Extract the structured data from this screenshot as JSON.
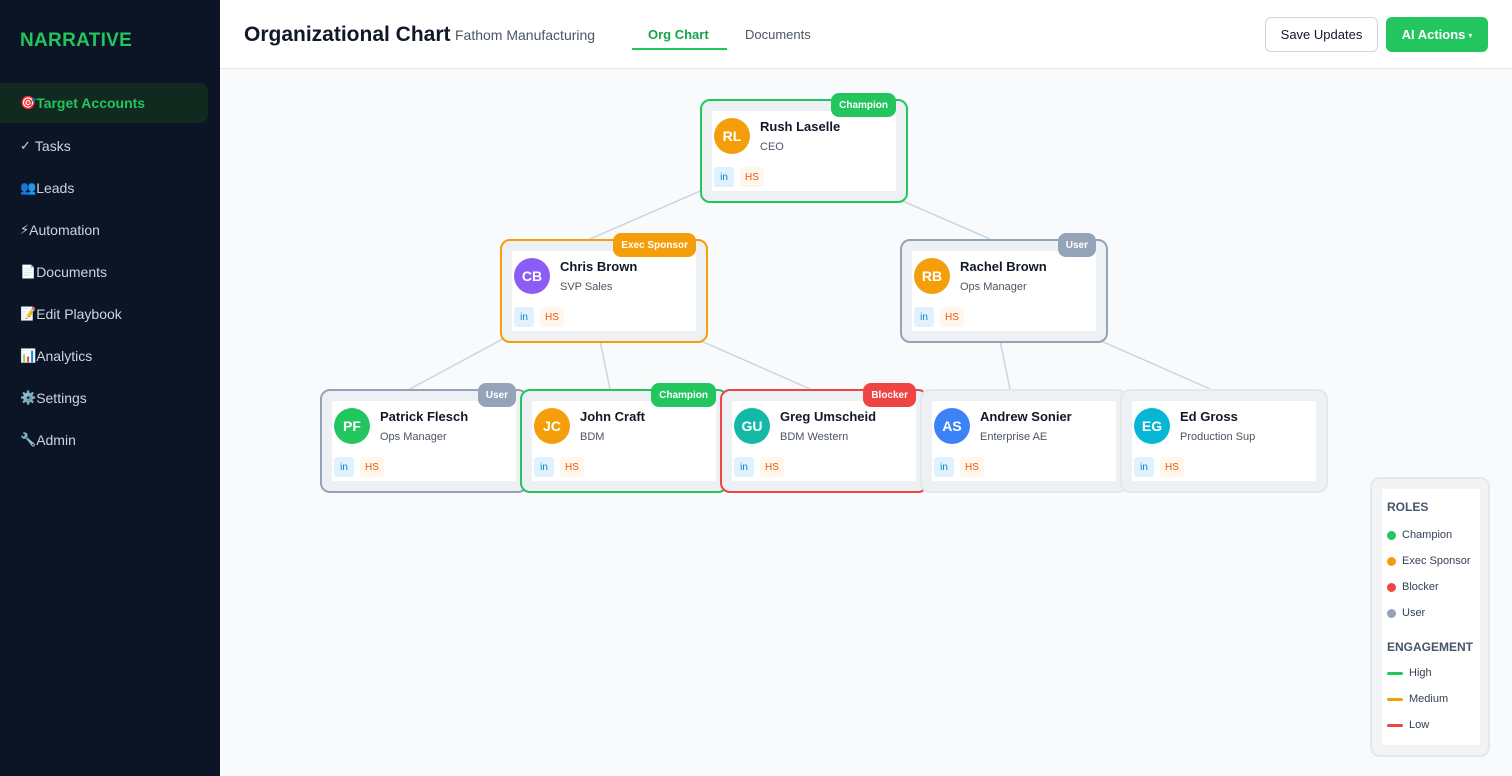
{
  "sidebar": {
    "brand": "NARRATIVE",
    "items": [
      {
        "icon": "🎯",
        "icon_name": "target-icon",
        "label": "Target Accounts",
        "active": true
      },
      {
        "icon": "✓",
        "icon_name": "check-icon",
        "label": "Tasks"
      },
      {
        "icon": "👥",
        "icon_name": "users-icon",
        "label": "Leads"
      },
      {
        "icon": "⚡",
        "icon_name": "lightning-icon",
        "label": "Automation"
      },
      {
        "icon": "📄",
        "icon_name": "document-icon",
        "label": "Documents"
      },
      {
        "icon": "📝",
        "icon_name": "memo-icon",
        "label": "Edit Playbook"
      },
      {
        "icon": "📊",
        "icon_name": "bar-chart-icon",
        "label": "Analytics"
      },
      {
        "icon": "⚙️",
        "icon_name": "gear-icon",
        "label": "Settings"
      },
      {
        "icon": "🔧",
        "icon_name": "wrench-icon",
        "label": "Admin"
      }
    ]
  },
  "header": {
    "title": "Organizational Chart",
    "company": "Fathom Manufacturing",
    "tabs": [
      {
        "label": "Org Chart",
        "active": true
      },
      {
        "label": "Documents"
      }
    ],
    "save_label": "Save Updates",
    "ai_label": "AI Actions",
    "ai_caret": "▾"
  },
  "people": [
    {
      "initials": "RL",
      "name": "Rush Laselle",
      "title": "CEO",
      "role": "Champion",
      "avatar_color": "#f59e0b",
      "in_label": "in",
      "hs_label": "HS"
    },
    {
      "initials": "CB",
      "name": "Chris Brown",
      "title": "SVP Sales",
      "role": "Exec Sponsor",
      "avatar_color": "#8b5cf6",
      "in_label": "in",
      "hs_label": "HS"
    },
    {
      "initials": "RB",
      "name": "Rachel Brown",
      "title": "Ops Manager",
      "role": "User",
      "avatar_color": "#f59e0b",
      "in_label": "in",
      "hs_label": "HS"
    },
    {
      "initials": "PF",
      "name": "Patrick Flesch",
      "title": "Ops Manager",
      "role": "User",
      "avatar_color": "#22c55e",
      "in_label": "in",
      "hs_label": "HS"
    },
    {
      "initials": "JC",
      "name": "John Craft",
      "title": "BDM",
      "role": "Champion",
      "avatar_color": "#f59e0b",
      "in_label": "in",
      "hs_label": "HS"
    },
    {
      "initials": "GU",
      "name": "Greg Umscheid",
      "title": "BDM Western",
      "role": "Blocker",
      "avatar_color": "#14b8a6",
      "in_label": "in",
      "hs_label": "HS"
    },
    {
      "initials": "AS",
      "name": "Andrew Sonier",
      "title": "Enterprise AE",
      "role": "",
      "avatar_color": "#3b82f6",
      "in_label": "in",
      "hs_label": "HS"
    },
    {
      "initials": "EG",
      "name": "Ed Gross",
      "title": "Production Sup",
      "role": "",
      "avatar_color": "#06b6d4",
      "in_label": "in",
      "hs_label": "HS"
    }
  ],
  "legend": {
    "roles_heading": "ROLES",
    "roles": [
      {
        "label": "Champion",
        "color": "#22c55e"
      },
      {
        "label": "Exec Sponsor",
        "color": "#f59e0b"
      },
      {
        "label": "Blocker",
        "color": "#ef4444"
      },
      {
        "label": "User",
        "color": "#94a3b8"
      }
    ],
    "engagement_heading": "ENGAGEMENT",
    "engagement": [
      {
        "label": "High",
        "color": "#22c55e"
      },
      {
        "label": "Medium",
        "color": "#f59e0b"
      },
      {
        "label": "Low",
        "color": "#ef4444"
      }
    ]
  },
  "colors": {
    "accent": "#22c55e",
    "sidebar_bg": "#0b1526",
    "champion": "#22c55e",
    "exec_sponsor": "#f59e0b",
    "blocker": "#ef4444",
    "user": "#94a3b8"
  }
}
